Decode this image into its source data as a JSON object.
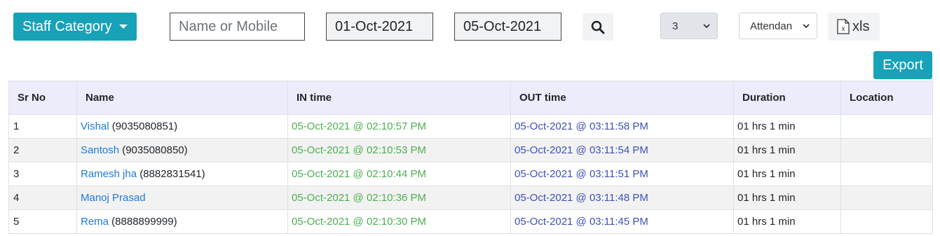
{
  "toolbar": {
    "staff_category_label": "Staff Category",
    "search_placeholder": "Name or Mobile",
    "from_date": "01-Oct-2021",
    "to_date": "05-Oct-2021",
    "count_select_value": "3",
    "type_select_value": "Attendan",
    "xls_label": "xls",
    "export_label": "Export"
  },
  "table": {
    "headers": [
      "Sr No",
      "Name",
      "IN time",
      "OUT time",
      "Duration",
      "Location"
    ],
    "rows": [
      {
        "sr": "1",
        "name": "Vishal",
        "mobile": " (9035080851)",
        "in": "05-Oct-2021 @ 02:10:57 PM",
        "out": "05-Oct-2021 @ 03:11:58 PM",
        "duration": "01 hrs 1 min",
        "location": ""
      },
      {
        "sr": "2",
        "name": "Santosh",
        "mobile": " (9035080850)",
        "in": "05-Oct-2021 @ 02:10:53 PM",
        "out": "05-Oct-2021 @ 03:11:54 PM",
        "duration": "01 hrs 1 min",
        "location": ""
      },
      {
        "sr": "3",
        "name": "Ramesh jha",
        "mobile": " (8882831541)",
        "in": "05-Oct-2021 @ 02:10:44 PM",
        "out": "05-Oct-2021 @ 03:11:51 PM",
        "duration": "01 hrs 1 min",
        "location": ""
      },
      {
        "sr": "4",
        "name": "Manoj Prasad",
        "mobile": "",
        "in": "05-Oct-2021 @ 02:10:36 PM",
        "out": "05-Oct-2021 @ 03:11:48 PM",
        "duration": "01 hrs 1 min",
        "location": ""
      },
      {
        "sr": "5",
        "name": "Rema",
        "mobile": " (8888899999)",
        "in": "05-Oct-2021 @ 02:10:30 PM",
        "out": "05-Oct-2021 @ 03:11:45 PM",
        "duration": "01 hrs 1 min",
        "location": ""
      }
    ]
  },
  "colors": {
    "accent": "#17a2b8",
    "header_bg": "#ececfb",
    "link": "#1e7ad6",
    "in_time": "#4caf50",
    "out_time": "#3f51b5"
  },
  "icons": {
    "search": "search-icon",
    "excel": "excel-file-icon",
    "dropdown": "chevron-down-icon"
  }
}
